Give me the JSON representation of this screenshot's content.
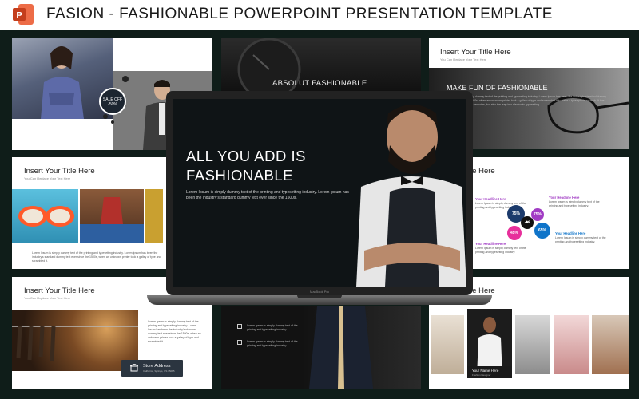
{
  "header": {
    "title": "FASION - FASHIONABLE POWERPOINT PRESENTATION TEMPLATE",
    "logo_letter": "P",
    "logo_color": "#d24726"
  },
  "hero": {
    "title_line1": "ALL YOU ADD IS",
    "title_line2": "FASHIONABLE",
    "text": "Lorem Ipsum is simply dummy text of the printing and typesetting industry. Lorem Ipsum has been the industry's standard dummy text ever since the 1500s.",
    "laptop_label": "MacBook Pro"
  },
  "slide1": {
    "badge_line1": "SALE OFF",
    "badge_line2": "-50%"
  },
  "slide2": {
    "title": "ABSOLUT FASHIONABLE"
  },
  "slide3": {
    "title": "Insert Your Title Here",
    "subtitle": "You Can Replace Your Text Here",
    "banner": "MAKE FUN OF FASHIONABLE",
    "para": "Lorem Ipsum is simply dummy text of the printing and typesetting industry. Lorem Ipsum has been the industry's standard dummy text ever since the 1500s, when an unknown printer took a galley of type and scrambled it to make a type specimen book. It has survived not only five centuries, but also the leap into electronic typesetting."
  },
  "slide4": {
    "title": "Insert Your Title Here",
    "subtitle": "You Can Replace Your Text Here",
    "para": "Lorem Ipsum is simply dummy text of the printing and typesetting industry. Lorem Ipsum has been the industry's standard dummy text ever since the 1500s, when an unknown printer took a galley of type and scrambled it."
  },
  "slide6": {
    "title_partial": "Insert Your Title Here",
    "headline": "Your Headline Here",
    "text": "Lorem Ipsum is simply dummy text of the printing and typesetting industry.",
    "circles": [
      "75%",
      "75%",
      "45%",
      "65%"
    ],
    "colors": [
      "#a13cc4",
      "#e72f9b",
      "#1b3a6b",
      "#0f74c9"
    ]
  },
  "slide7": {
    "title": "Insert Your Title Here",
    "subtitle": "You Can Replace Your Text Here",
    "para": "Lorem Ipsum is simply dummy text of the printing and typesetting industry. Lorem Ipsum has been the industry's standard dummy text ever since the 1500s, when an unknown printer took a galley of type and scrambled it.",
    "store_button": "Store Address",
    "store_sub": "California, Springs, US 35085"
  },
  "slide8": {
    "items": [
      "Lorem Ipsum is simply dummy text of the printing and typesetting industry.",
      "Lorem Ipsum is simply dummy text of the printing and typesetting industry."
    ]
  },
  "slide9": {
    "title_partial": "Insert Your Title Here",
    "name": "Your Name Here",
    "role": "Fashion Designer"
  }
}
